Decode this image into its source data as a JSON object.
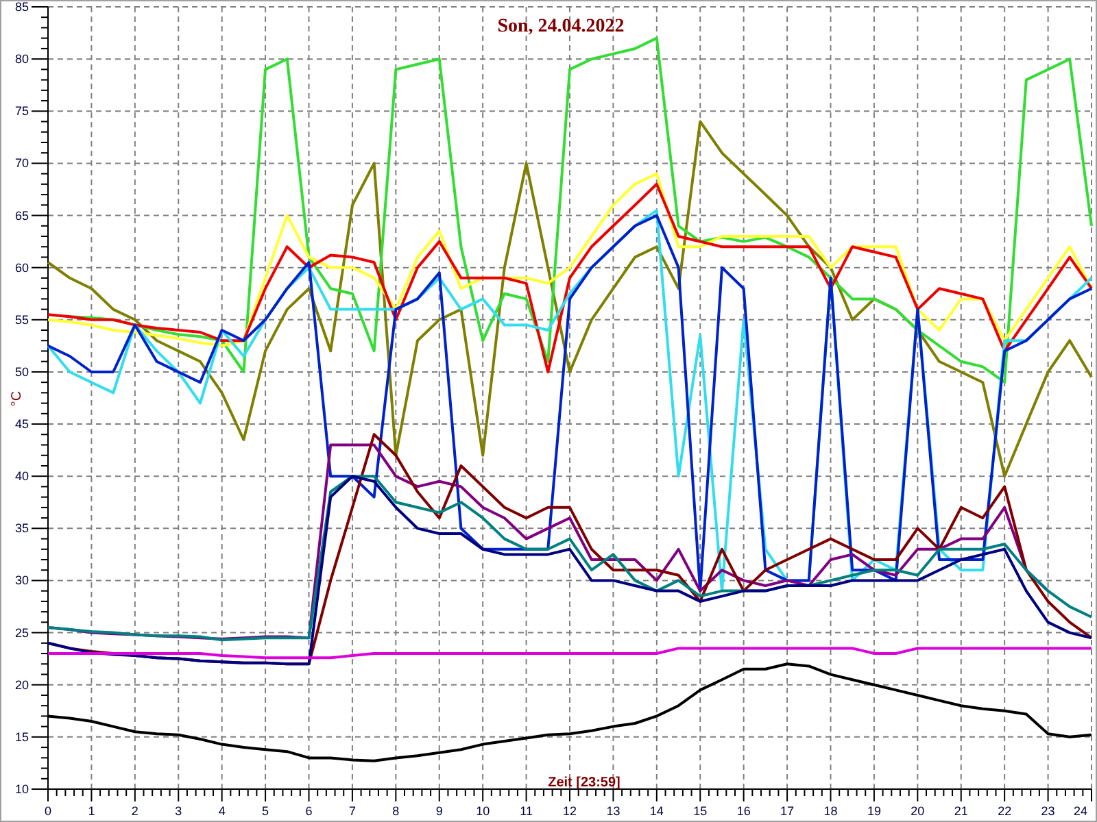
{
  "chart": {
    "chart_data": {
      "type": "line",
      "title": "Son, 24.04.2022",
      "xlabel": "Zeit [23:59]",
      "ylabel": "°C",
      "grid": true,
      "xlim": [
        0,
        24
      ],
      "ylim": [
        10,
        85
      ],
      "xticks": [
        0,
        1,
        2,
        3,
        4,
        5,
        6,
        7,
        8,
        9,
        10,
        11,
        12,
        13,
        14,
        15,
        16,
        17,
        18,
        19,
        20,
        21,
        22,
        23,
        24
      ],
      "yticks": [
        10,
        15,
        20,
        25,
        30,
        35,
        40,
        45,
        50,
        55,
        60,
        65,
        70,
        75,
        80,
        85
      ],
      "x": [
        0,
        0.5,
        1,
        1.5,
        2,
        2.5,
        3,
        3.5,
        4,
        4.5,
        5,
        5.5,
        6,
        6.5,
        7,
        7.5,
        8,
        8.5,
        9,
        9.5,
        10,
        10.5,
        11,
        11.5,
        12,
        12.5,
        13,
        13.5,
        14,
        14.5,
        15,
        15.5,
        16,
        16.5,
        17,
        17.5,
        18,
        18.5,
        19,
        19.5,
        20,
        20.5,
        21,
        21.5,
        22,
        22.5,
        23,
        23.5,
        24
      ],
      "series": [
        {
          "color": "#808000",
          "values": [
            60.5,
            59,
            58,
            56,
            55,
            53,
            52,
            51,
            48,
            43.5,
            52,
            56,
            58,
            52,
            66,
            70,
            42,
            53,
            55,
            56,
            42,
            60,
            70,
            60,
            50,
            55,
            58,
            61,
            62,
            58,
            74,
            71,
            69,
            67,
            65,
            62,
            60,
            55,
            57,
            56,
            54,
            51,
            50,
            49,
            40,
            45,
            50,
            53,
            49.5
          ]
        },
        {
          "color": "#33dd33",
          "values": [
            null,
            55.3,
            55.2,
            55,
            54.5,
            54,
            53.6,
            53.4,
            53,
            50,
            79,
            80,
            61,
            58,
            57.5,
            52,
            79,
            79.5,
            80,
            62,
            53,
            57.5,
            57,
            51,
            79,
            80,
            80.5,
            81,
            82,
            64,
            62.5,
            62.9,
            62.5,
            62.9,
            62,
            61,
            59,
            57,
            57,
            56,
            54,
            52.5,
            51,
            50.5,
            49,
            78,
            79,
            80,
            64
          ]
        },
        {
          "color": "#ffff33",
          "values": [
            55,
            54.8,
            54.5,
            54,
            53.8,
            53.5,
            53.2,
            52.8,
            52.5,
            53,
            59,
            65,
            61,
            60,
            60,
            59,
            56,
            61,
            63.5,
            58,
            59,
            59,
            59,
            58.5,
            60,
            63,
            66,
            68,
            69,
            62,
            62,
            63,
            63,
            63,
            63,
            63,
            60,
            62,
            62,
            62,
            56,
            54,
            57,
            57,
            53,
            56,
            59,
            62,
            58
          ]
        },
        {
          "color": "#ee0000",
          "values": [
            55.5,
            55.3,
            55,
            55,
            54.5,
            54.2,
            54,
            53.8,
            53,
            53,
            58,
            62,
            60,
            61.2,
            61,
            60.5,
            55,
            60,
            62.5,
            59,
            59,
            59,
            58.5,
            50,
            59,
            62,
            64,
            66,
            68,
            63,
            62.5,
            62,
            62,
            62,
            62,
            62,
            58,
            62,
            61.5,
            61,
            56,
            58,
            57.5,
            57,
            52,
            55,
            58,
            61,
            58
          ]
        },
        {
          "color": "#33ddee",
          "values": [
            52.5,
            50,
            49,
            48,
            54.5,
            52,
            50,
            47,
            54,
            51.5,
            55,
            58,
            60,
            56,
            56,
            56,
            56,
            57,
            59,
            56,
            57,
            54.5,
            54.5,
            54,
            57.5,
            60,
            62,
            64,
            65.5,
            40,
            53.5,
            29,
            55,
            33,
            30,
            30,
            59,
            30,
            32,
            31,
            56,
            33,
            31,
            31,
            53,
            53,
            55,
            57,
            59
          ]
        },
        {
          "color": "#0022cc",
          "values": [
            52.5,
            51.5,
            50,
            50,
            54.5,
            51,
            50,
            49,
            54,
            53,
            55,
            58,
            60.5,
            40,
            40,
            38,
            56,
            57,
            59.5,
            35,
            33,
            33,
            33,
            33,
            57,
            60,
            62,
            64,
            65,
            60,
            29,
            60,
            58,
            31,
            30,
            30,
            59,
            31,
            31,
            30,
            56,
            32,
            32,
            32,
            52,
            53,
            55,
            57,
            58
          ]
        },
        {
          "color": "#800080",
          "values": [
            25.5,
            25.3,
            25,
            24.9,
            24.8,
            24.7,
            24.6,
            24.5,
            24.4,
            24.5,
            24.6,
            24.6,
            24.5,
            43,
            43,
            43,
            40,
            39,
            39.5,
            39,
            37,
            36,
            34,
            35,
            36,
            32,
            32,
            32,
            30,
            33,
            29,
            31,
            30,
            29.5,
            30,
            29.5,
            32,
            32.5,
            31,
            30.5,
            33,
            33,
            34,
            34,
            37,
            31,
            29,
            null,
            null
          ]
        },
        {
          "color": "#800000",
          "values": [
            24,
            23.5,
            23.2,
            23,
            22.8,
            22.6,
            22.5,
            22.3,
            22.2,
            22.1,
            22.1,
            22,
            22,
            30,
            37,
            44,
            42,
            38.5,
            36,
            41,
            39,
            37,
            36,
            37,
            37,
            33,
            31,
            31,
            31,
            30.5,
            28,
            33,
            29,
            31,
            32,
            33,
            34,
            33,
            32,
            32,
            35,
            33,
            37,
            36,
            39,
            31,
            28,
            26,
            24.5
          ]
        },
        {
          "color": "#008080",
          "values": [
            25.5,
            25.3,
            25.1,
            25,
            24.8,
            24.7,
            24.7,
            24.6,
            24.3,
            24.4,
            24.5,
            24.5,
            24.5,
            38.5,
            40,
            40,
            37.5,
            37,
            36.5,
            37.5,
            36,
            34,
            33,
            33,
            34,
            31,
            32.5,
            30,
            29,
            30,
            28.5,
            29,
            29,
            29,
            29.5,
            29.5,
            30,
            30.5,
            31,
            31,
            30.5,
            33,
            33,
            33,
            33.5,
            31,
            29,
            27.5,
            26.5
          ]
        },
        {
          "color": "#000080",
          "values": [
            24,
            23.5,
            23.1,
            22.9,
            22.8,
            22.6,
            22.5,
            22.3,
            22.2,
            22.1,
            22.1,
            22,
            22,
            38,
            40,
            39.5,
            37,
            35,
            34.5,
            34.5,
            33,
            32.5,
            32.5,
            32.5,
            33,
            30,
            30,
            29.5,
            29,
            29,
            28,
            28.5,
            29,
            29,
            29.5,
            29.5,
            29.5,
            30,
            30,
            30,
            30,
            31,
            32,
            32.5,
            33,
            29,
            26,
            25,
            24.5
          ]
        },
        {
          "color": "#dd00dd",
          "values": [
            23,
            23,
            23,
            23,
            23,
            23,
            23,
            23,
            22.8,
            22.7,
            22.6,
            22.6,
            22.6,
            22.6,
            22.8,
            23,
            23,
            23,
            23,
            23,
            23,
            23,
            23,
            23,
            23,
            23,
            23,
            23,
            23,
            23.5,
            23.5,
            23.5,
            23.5,
            23.5,
            23.5,
            23.5,
            23.5,
            23.5,
            23,
            23,
            23.5,
            23.5,
            23.5,
            23.5,
            23.5,
            23.5,
            23.5,
            23.5,
            23.5
          ]
        },
        {
          "color": "#000000",
          "values": [
            17,
            16.8,
            16.5,
            16,
            15.5,
            15.3,
            15.2,
            14.8,
            14.3,
            14,
            13.8,
            13.6,
            13,
            13,
            12.8,
            12.7,
            13,
            13.2,
            13.5,
            13.8,
            14.3,
            14.6,
            14.9,
            15.2,
            15.3,
            15.6,
            16,
            16.3,
            17,
            18,
            19.5,
            20.5,
            21.5,
            21.5,
            22,
            21.8,
            21,
            20.5,
            20,
            19.5,
            19,
            18.5,
            18,
            17.7,
            17.5,
            17.2,
            15.3,
            15,
            15.2
          ]
        }
      ]
    }
  }
}
